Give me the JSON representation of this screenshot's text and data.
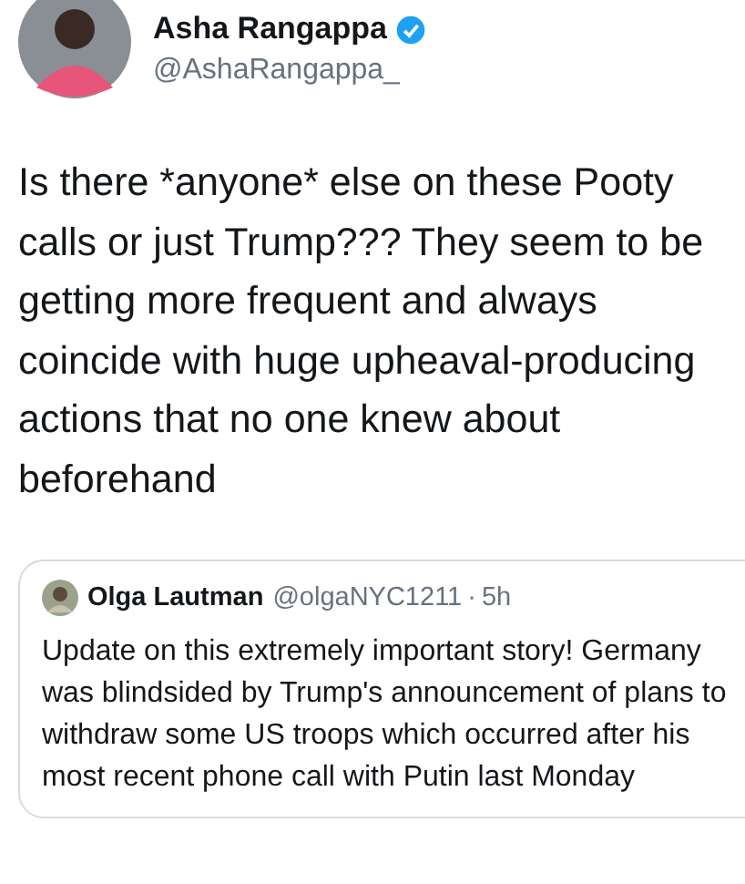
{
  "tweet": {
    "author": {
      "name": "Asha Rangappa",
      "handle": "@AshaRangappa_",
      "verified": true
    },
    "text": "Is there *anyone* else on these Pooty calls or just Trump??? They seem to be getting more frequent and always coincide with huge upheaval-producing actions that no one knew about beforehand",
    "quoted_tweet": {
      "author": {
        "name": "Olga Lautman",
        "handle": "@olgaNYC1211"
      },
      "separator": "·",
      "time": "5h",
      "text": "Update on this extremely important story! Germany was blindsided by Trump's announcement of plans to withdraw some US troops which occurred after his most recent phone call with Putin last Monday"
    }
  }
}
